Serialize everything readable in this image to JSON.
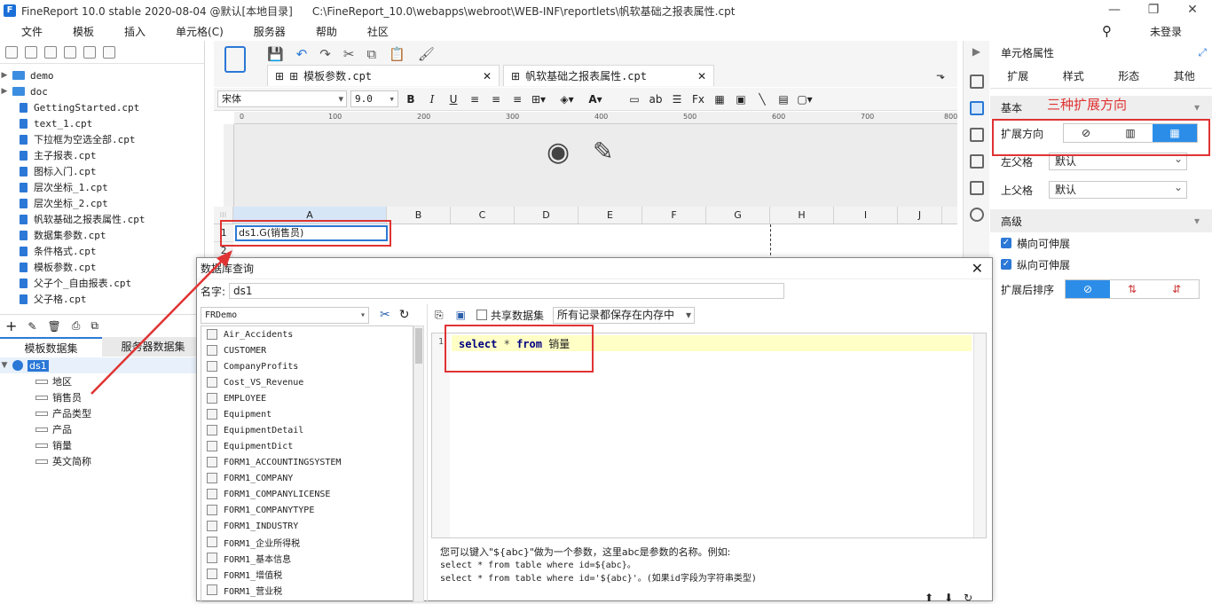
{
  "titlebar": {
    "app_title": "FineReport 10.0 stable 2020-08-04 @默认[本地目录]",
    "file_path": "C:\\FineReport_10.0\\webapps\\webroot\\WEB-INF\\reportlets\\帆软基础之报表属性.cpt"
  },
  "menu": [
    "文件",
    "模板",
    "插入",
    "单元格(C)",
    "服务器",
    "帮助",
    "社区"
  ],
  "user": {
    "login_label": "未登录"
  },
  "file_tree": {
    "folders": [
      "demo",
      "doc"
    ],
    "files": [
      "GettingStarted.cpt",
      "text_1.cpt",
      "下拉框为空选全部.cpt",
      "主子报表.cpt",
      "图标入门.cpt",
      "层次坐标_1.cpt",
      "层次坐标_2.cpt",
      "帆软基础之报表属性.cpt",
      "数据集参数.cpt",
      "条件格式.cpt",
      "模板参数.cpt",
      "父子个_自由报表.cpt",
      "父子格.cpt"
    ]
  },
  "dataset_panel": {
    "tabs": [
      "模板数据集",
      "服务器数据集"
    ],
    "dataset_name": "ds1",
    "fields": [
      "地区",
      "销售员",
      "产品类型",
      "产品",
      "销量",
      "英文简称"
    ]
  },
  "editor_tabs": [
    "模板参数.cpt",
    "帆软基础之报表属性.cpt"
  ],
  "format": {
    "font": "宋体",
    "size": "9.0"
  },
  "ruler_ticks": [
    "0",
    "100",
    "200",
    "300",
    "400",
    "500",
    "600",
    "700",
    "800"
  ],
  "columns": [
    "A",
    "B",
    "C",
    "D",
    "E",
    "F",
    "G",
    "H",
    "I",
    "J"
  ],
  "rows": [
    "1",
    "2"
  ],
  "cell_a1": "ds1.G(销售员)",
  "right_panel": {
    "title": "单元格属性",
    "tabs": [
      "扩展",
      "样式",
      "形态",
      "其他"
    ],
    "section_basic": "基本",
    "annotation": "三种扩展方向",
    "expand_direction_label": "扩展方向",
    "left_parent_label": "左父格",
    "left_parent_value": "默认",
    "top_parent_label": "上父格",
    "top_parent_value": "默认",
    "section_advanced": "高级",
    "horizontal_expand": "横向可伸展",
    "vertical_expand": "纵向可伸展",
    "sort_label": "扩展后排序"
  },
  "dialog": {
    "title": "数据库查询",
    "name_label": "名字:",
    "name_value": "ds1",
    "connection": "FRDemo",
    "share_label": "共享数据集",
    "memory_option": "所有记录都保存在内存中",
    "tables": [
      "Air_Accidents",
      "CUSTOMER",
      "CompanyProfits",
      "Cost_VS_Revenue",
      "EMPLOYEE",
      "Equipment",
      "EquipmentDetail",
      "EquipmentDict",
      "FORM1_ACCOUNTINGSYSTEM",
      "FORM1_COMPANY",
      "FORM1_COMPANYLICENSE",
      "FORM1_COMPANYTYPE",
      "FORM1_INDUSTRY",
      "FORM1_企业所得税",
      "FORM1_基本信息",
      "FORM1_增值税",
      "FORM1_营业税"
    ],
    "sql_line_no": "1",
    "sql_kw1": "select",
    "sql_star": "*",
    "sql_kw2": "from",
    "sql_table": "销量",
    "hint_line1": "您可以键入\"${abc}\"做为一个参数，这里abc是参数的名称。例如:",
    "hint_line2": "select * from table where id=${abc}。",
    "hint_line3": "select * from table where id='${abc}'。(如果id字段为字符串类型)"
  },
  "colors": {
    "accent": "#2b8de8",
    "annotation_red": "#e03333"
  }
}
